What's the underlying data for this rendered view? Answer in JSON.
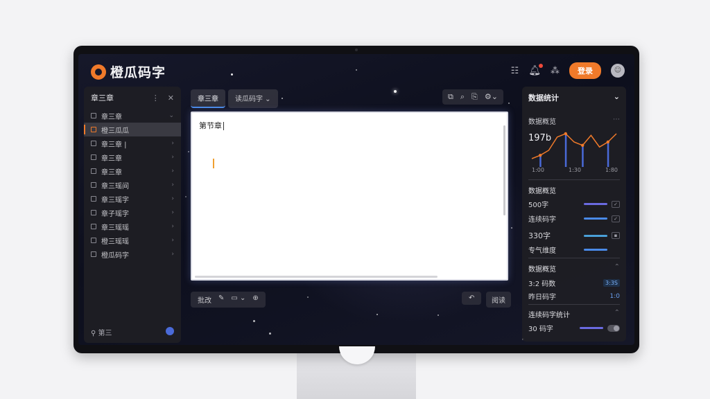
{
  "app": {
    "logo_text": "橙瓜码字"
  },
  "header": {
    "login_label": "登录",
    "grid_icon": "grid-icon",
    "bell_icon": "bell-icon",
    "app_icon": "apps-icon",
    "avatar_icon": "avatar-icon"
  },
  "sidebar": {
    "title": "章三章",
    "items": [
      {
        "label": "章三章",
        "chev": "⌄"
      },
      {
        "label": "橙三瓜瓜",
        "chev": ""
      },
      {
        "label": "章三章 |",
        "chev": "›"
      },
      {
        "label": "章三章",
        "chev": "›"
      },
      {
        "label": "章三章",
        "chev": "›"
      },
      {
        "label": "章三瑶间",
        "chev": "›"
      },
      {
        "label": "章三瑶字",
        "chev": "›"
      },
      {
        "label": "章子瑶字",
        "chev": "›"
      },
      {
        "label": "章三瑶瑶",
        "chev": "›"
      },
      {
        "label": "橙三瑶瑶",
        "chev": "›"
      },
      {
        "label": "橙瓜码字",
        "chev": "›"
      }
    ],
    "footer_label": "第三"
  },
  "tabs": [
    {
      "label": "章三章"
    },
    {
      "label": "读瓜码字 ⌄"
    }
  ],
  "editor": {
    "title": "第节章"
  },
  "bottom": {
    "left_label": "批改",
    "right_label": "阅读"
  },
  "stats": {
    "title": "数据统计",
    "section1": "数据概览",
    "big_number": "197b",
    "axis": [
      "1:00",
      "1:30",
      "1:80"
    ],
    "chart_data": {
      "type": "line",
      "x": [
        0,
        1,
        2,
        3,
        4,
        5,
        6,
        7,
        8,
        9,
        10
      ],
      "values": [
        10,
        14,
        20,
        36,
        40,
        30,
        26,
        38,
        24,
        30,
        40
      ],
      "bars": [
        1,
        4,
        6,
        9
      ],
      "xticks": [
        "1:00",
        "1:30",
        "1:80"
      ]
    },
    "section2": "数据概览",
    "rows_a": [
      {
        "label": "500字",
        "check": "✓"
      },
      {
        "label": "连续码字",
        "check": "✓"
      },
      {
        "label": "330字",
        "check": "▪"
      },
      {
        "label": "专气维度",
        "check": ""
      }
    ],
    "section3": "数据概览",
    "row_b1": {
      "label": "3:2 码数",
      "badge": "3:3S"
    },
    "row_b2": {
      "label": "昨日码字",
      "value": "1:0"
    },
    "section4": "连续码字统计",
    "row_c": {
      "label": "30 码字"
    },
    "colors": {
      "accent": "#f07a2a",
      "bar": "#6a6ae0",
      "link": "#6aa0f0"
    }
  }
}
